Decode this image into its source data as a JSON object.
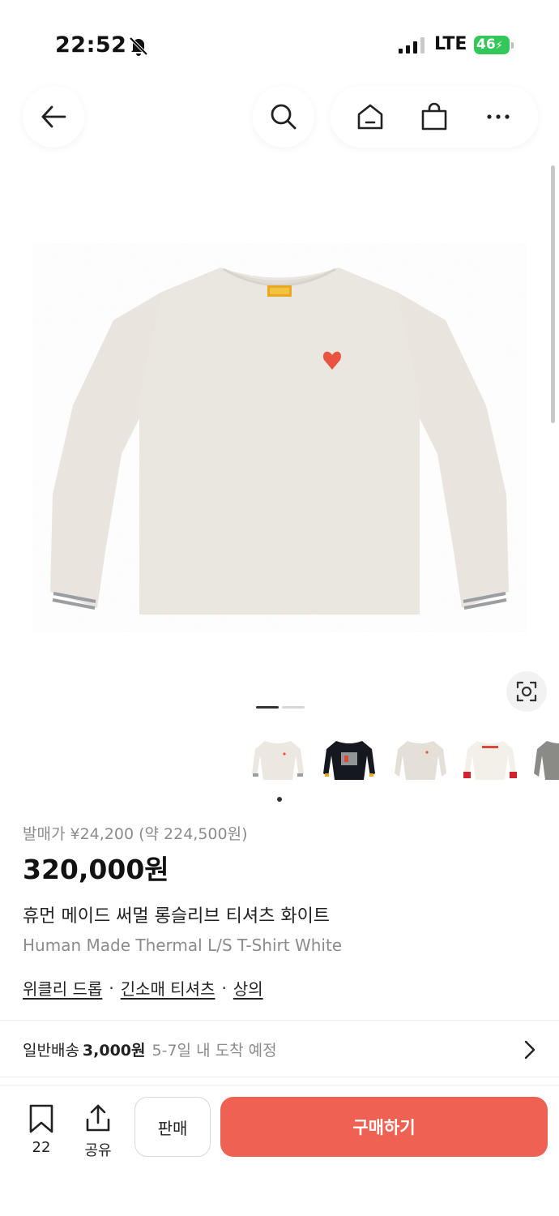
{
  "status_bar": {
    "time": "22:52",
    "network": "LTE",
    "battery": "46"
  },
  "header": {
    "icons": [
      "back-arrow-icon",
      "search-icon",
      "home-icon",
      "shopping-bag-icon",
      "more-icon"
    ]
  },
  "gallery": {
    "slide_count": 2,
    "active_slide": 1,
    "thumbnails": [
      {
        "name": "thumb-oatmeal-longsleeve",
        "color": "#ece8e1"
      },
      {
        "name": "thumb-black-graphic-longsleeve",
        "color": "#15181f"
      },
      {
        "name": "thumb-oatmeal-longsleeve-2",
        "color": "#e4e0d8"
      },
      {
        "name": "thumb-white-red-cuff-longsleeve",
        "color": "#f3efe9"
      },
      {
        "name": "thumb-gray-longsleeve",
        "color": "#8a8a86"
      }
    ]
  },
  "product": {
    "release_price": "발매가 ¥24,200 (약 224,500원)",
    "price": "320,000원",
    "name_ko": "휴먼 메이드 써멀 롱슬리브 티셔츠 화이트",
    "name_en": "Human Made Thermal L/S T-Shirt White",
    "tags": [
      "위클리 드롭",
      "긴소매 티셔츠",
      "상의"
    ],
    "tag_separator": "·"
  },
  "shipping": {
    "label": "일반배송",
    "price": "3,000원",
    "eta": "5-7일 내 도착 예정"
  },
  "bottom_bar": {
    "wish_count": "22",
    "share_label": "공유",
    "sell_label": "판매",
    "buy_label": "구매하기"
  },
  "colors": {
    "accent": "#ef6253",
    "sweater": "#ebe6df",
    "stripe": "#9a9ea3"
  }
}
